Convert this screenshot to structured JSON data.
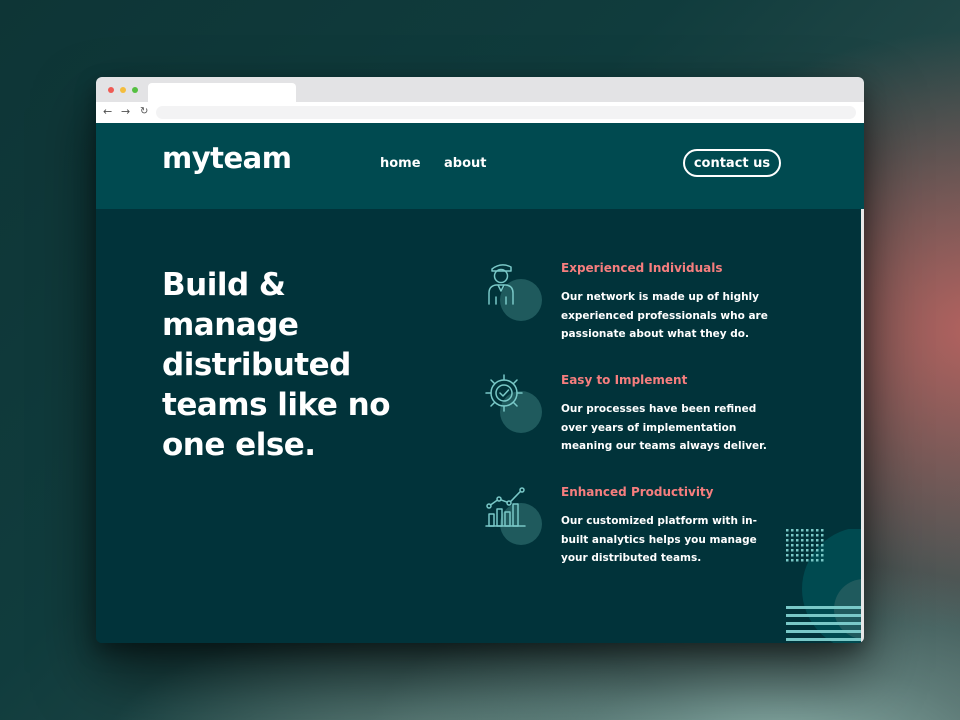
{
  "site": {
    "logo": "myteam",
    "nav": {
      "home": "home",
      "about": "about"
    },
    "contact_label": "contact us"
  },
  "hero": {
    "title": "Build & manage distributed teams like no one else."
  },
  "features": [
    {
      "icon": "person-icon",
      "title": "Experienced Individuals",
      "description": "Our network is made up of highly experienced professionals who are passionate about what they do."
    },
    {
      "icon": "gear-check-icon",
      "title": "Easy to Implement",
      "description": "Our processes have been refined over years of implementation meaning our teams always deliver."
    },
    {
      "icon": "chart-icon",
      "title": "Enhanced Productivity",
      "description": "Our customized platform with in-built analytics helps you manage your distributed teams."
    }
  ],
  "colors": {
    "header_bg": "#004a50",
    "main_bg": "#01333a",
    "accent_coral": "#f67e7e",
    "accent_teal": "#79c8c7",
    "text": "#ffffff"
  }
}
